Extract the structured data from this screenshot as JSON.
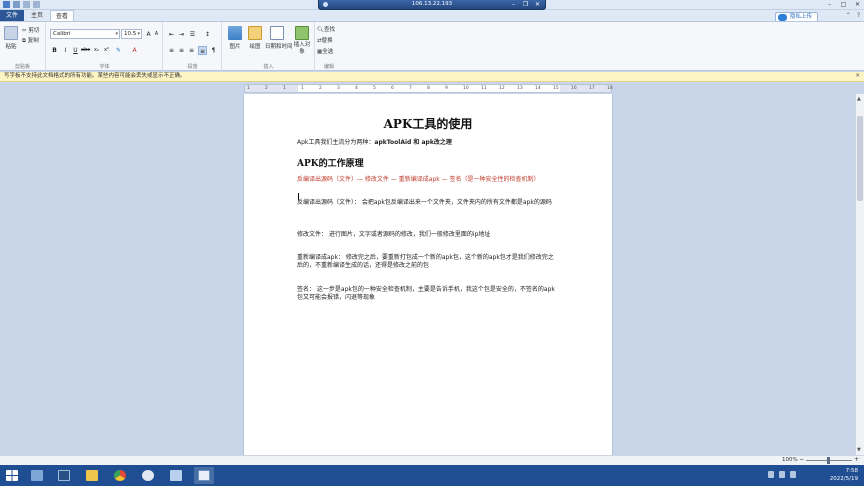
{
  "titlebar": {
    "remote_host": "106.13.22.193"
  },
  "tabs": {
    "file": "文件",
    "home": "主页",
    "view": "查看"
  },
  "cloud_button": "隐私上传",
  "ribbon": {
    "clipboard": {
      "paste": "粘贴",
      "cut": "剪切",
      "copy": "复制",
      "label": "剪贴板"
    },
    "font": {
      "name": "Calibri",
      "size": "10.5",
      "label": "字体"
    },
    "paragraph": {
      "label": "段落"
    },
    "insert": {
      "picture": "图片",
      "paint": "绘图",
      "datetime": "日期和时间",
      "object": "插入对象",
      "label": "插入"
    },
    "edit": {
      "find": "查找",
      "replace": "替换",
      "select_all": "全选",
      "label": "编辑"
    }
  },
  "infobar": {
    "message": "写字板不支持此文档格式的所有功能。某些内容可能会丢失或显示不正确。"
  },
  "ruler": {
    "ticks": [
      "1",
      "2",
      "1",
      "1",
      "2",
      "3",
      "4",
      "5",
      "6",
      "7",
      "8",
      "9",
      "10",
      "11",
      "12",
      "13",
      "14",
      "15",
      "16",
      "17",
      "18"
    ]
  },
  "document": {
    "title": "APK工具的使用",
    "intro_prefix": "Apk工具我们主流分为两种：",
    "intro_tools": "apkToolAid 和 apk改之理",
    "heading": "APK的工作原理",
    "flow": "反编译出源码（文件）— 修改文件 — 重新编译成apk — 签名（是一种安全性的检查机制）",
    "step1": "反编译出源码（文件）：  会把apk包反编译出来一个文件夹，文件夹内的所有文件都是apk的源码",
    "step2": "修改文件：        进行图片，文字或者源码的修改，我们一般修改里面的ip地址",
    "step3": "重新编译成apk：      修改完之后，要重新打包成一个新的apk包，这个新的apk包才是我们修改完之后的，不重新编译生成的话，还得是修改之前的包",
    "step4": "签名：          这一步是apk包的一种安全检查机制，主要是告诉手机，我这个包是安全的，不签名的apk包又可能会报错，闪退等现象"
  },
  "statusbar": {
    "zoom": "100%",
    "minus": "−",
    "plus": "+"
  },
  "clock": {
    "time": "7:58",
    "date": "2022/5/19"
  }
}
